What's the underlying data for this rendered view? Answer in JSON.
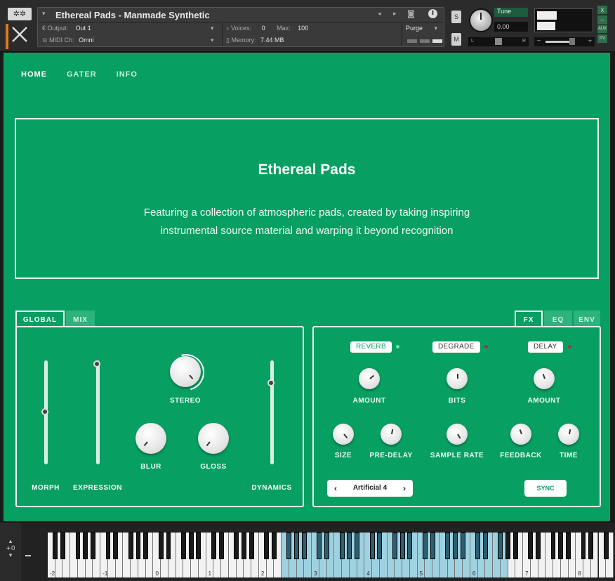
{
  "kontakt": {
    "tool_icon": "✲✲",
    "instrument_name": "Ethereal Pads - Manmade Synthetic",
    "output_label": "Output:",
    "output_value": "Out 1",
    "voices_label": "Voices:",
    "voices_value": "0",
    "max_label": "Max:",
    "max_value": "100",
    "midi_label": "MIDI Ch:",
    "midi_value": "Omni",
    "memory_label": "Memory:",
    "memory_value": "7.44 MB",
    "purge_label": "Purge",
    "solo_label": "S",
    "mute_label": "M",
    "tune_label": "Tune",
    "tune_value": "0.00",
    "pan_left": "L",
    "pan_right": "R",
    "aux_label": "AUX",
    "pv_label": "PV",
    "close_label": "x",
    "minimize_label": "–"
  },
  "nav": {
    "home": "HOME",
    "gater": "GATER",
    "info": "INFO"
  },
  "hero": {
    "title": "Ethereal Pads",
    "description": "Featuring a collection of atmospheric pads, created by taking inspiring instrumental source material and warping it beyond recognition"
  },
  "left_panel": {
    "tab_global": "GLOBAL",
    "tab_mix": "MIX",
    "morph": "MORPH",
    "expression": "EXPRESSION",
    "stereo": "STEREO",
    "blur": "BLUR",
    "gloss": "GLOSS",
    "dynamics": "DYNAMICS"
  },
  "right_panel": {
    "tab_fx": "FX",
    "tab_eq": "EQ",
    "tab_env": "ENV",
    "reverb": "REVERB",
    "degrade": "DEGRADE",
    "delay": "DELAY",
    "amount": "AMOUNT",
    "bits": "BITS",
    "amount2": "AMOUNT",
    "size": "SIZE",
    "pre_delay": "PRE-DELAY",
    "sample_rate": "SAMPLE RATE",
    "feedback": "FEEDBACK",
    "time": "TIME",
    "preset": "Artificial 4",
    "sync": "SYNC"
  },
  "keyboard": {
    "transpose": "+0",
    "octaves": [
      "-2",
      "-1",
      "0",
      "1",
      "2",
      "3",
      "4",
      "5",
      "6",
      "7",
      "8"
    ]
  },
  "colors": {
    "accent": "#089f62",
    "brand_orange": "#e07a1a",
    "key_highlight": "#9fd2e0"
  }
}
